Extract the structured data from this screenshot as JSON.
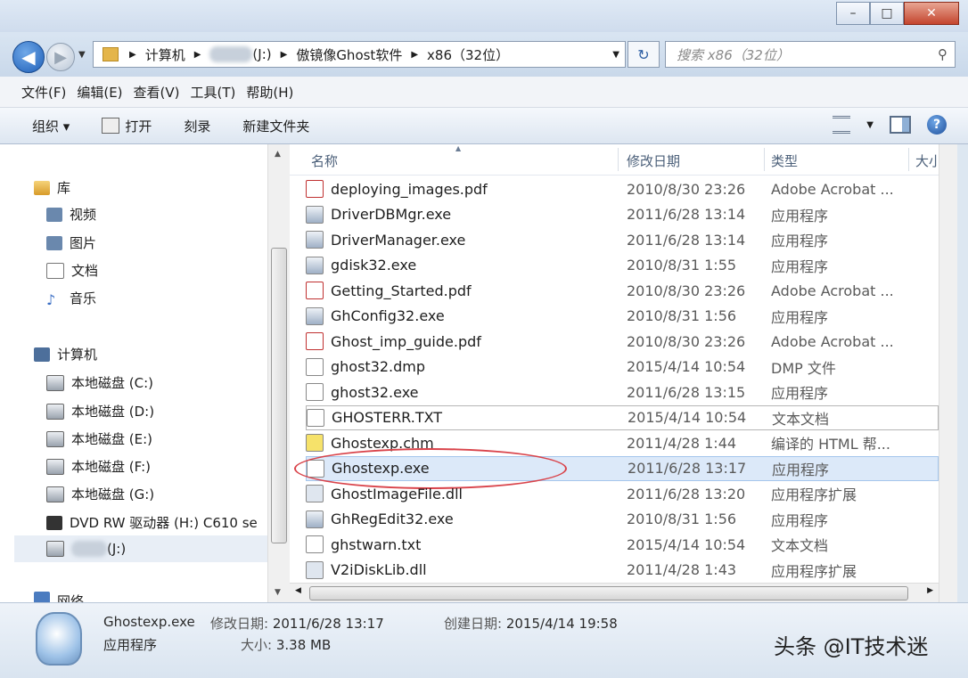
{
  "window": {
    "minimize": "–",
    "maximize": "□",
    "close": "✕"
  },
  "nav": {
    "back": "◀",
    "forward": "▶",
    "history": "▼"
  },
  "address": {
    "crumbs": [
      "计算机",
      "(J:)",
      "傲镜像Ghost软件",
      "x86（32位）"
    ],
    "dropdown": "▼"
  },
  "refresh": "↻",
  "search": {
    "placeholder": "搜索 x86（32位）",
    "icon": "search-icon"
  },
  "menu": [
    "文件(F)",
    "编辑(E)",
    "查看(V)",
    "工具(T)",
    "帮助(H)"
  ],
  "commands": {
    "organize": "组织 ▾",
    "open": "打开",
    "burn": "刻录",
    "new_folder": "新建文件夹",
    "help": "?"
  },
  "sidebar": {
    "library": "库",
    "lib_items": [
      "视频",
      "图片",
      "文档",
      "音乐"
    ],
    "computer": "计算机",
    "drives": [
      "本地磁盘 (C:)",
      "本地磁盘 (D:)",
      "本地磁盘 (E:)",
      "本地磁盘 (F:)",
      "本地磁盘 (G:)",
      "DVD RW 驱动器 (H:) C610 se",
      "(J:)"
    ],
    "network": "网络"
  },
  "columns": {
    "name": "名称",
    "date": "修改日期",
    "type": "类型",
    "size": "大小"
  },
  "files": [
    {
      "name": "deploying_images.pdf",
      "date": "2010/8/30 23:26",
      "type": "Adobe Acrobat ...",
      "icon": "pdf"
    },
    {
      "name": "DriverDBMgr.exe",
      "date": "2011/6/28 13:14",
      "type": "应用程序",
      "icon": "exe"
    },
    {
      "name": "DriverManager.exe",
      "date": "2011/6/28 13:14",
      "type": "应用程序",
      "icon": "exe"
    },
    {
      "name": "gdisk32.exe",
      "date": "2010/8/31 1:55",
      "type": "应用程序",
      "icon": "exe"
    },
    {
      "name": "Getting_Started.pdf",
      "date": "2010/8/30 23:26",
      "type": "Adobe Acrobat ...",
      "icon": "pdf"
    },
    {
      "name": "GhConfig32.exe",
      "date": "2010/8/31 1:56",
      "type": "应用程序",
      "icon": "exe"
    },
    {
      "name": "Ghost_imp_guide.pdf",
      "date": "2010/8/30 23:26",
      "type": "Adobe Acrobat ...",
      "icon": "pdf"
    },
    {
      "name": "ghost32.dmp",
      "date": "2015/4/14 10:54",
      "type": "DMP 文件",
      "icon": "txt"
    },
    {
      "name": "ghost32.exe",
      "date": "2011/6/28 13:15",
      "type": "应用程序",
      "icon": "ghost"
    },
    {
      "name": "GHOSTERR.TXT",
      "date": "2015/4/14 10:54",
      "type": "文本文档",
      "icon": "txt"
    },
    {
      "name": "Ghostexp.chm",
      "date": "2011/4/28 1:44",
      "type": "编译的 HTML 帮...",
      "icon": "chm"
    },
    {
      "name": "Ghostexp.exe",
      "date": "2011/6/28 13:17",
      "type": "应用程序",
      "icon": "ghost"
    },
    {
      "name": "GhostImageFile.dll",
      "date": "2011/6/28 13:20",
      "type": "应用程序扩展",
      "icon": "dll"
    },
    {
      "name": "GhRegEdit32.exe",
      "date": "2010/8/31 1:56",
      "type": "应用程序",
      "icon": "exe"
    },
    {
      "name": "ghstwarn.txt",
      "date": "2015/4/14 10:54",
      "type": "文本文档",
      "icon": "txt"
    },
    {
      "name": "V2iDiskLib.dll",
      "date": "2011/4/28 1:43",
      "type": "应用程序扩展",
      "icon": "dll"
    }
  ],
  "details": {
    "filename": "Ghostexp.exe",
    "modified_label": "修改日期:",
    "modified": "2011/6/28 13:17",
    "created_label": "创建日期:",
    "created": "2015/4/14 19:58",
    "kind": "应用程序",
    "size_label": "大小:",
    "size": "3.38 MB"
  },
  "watermark": "头条 @IT技术迷"
}
